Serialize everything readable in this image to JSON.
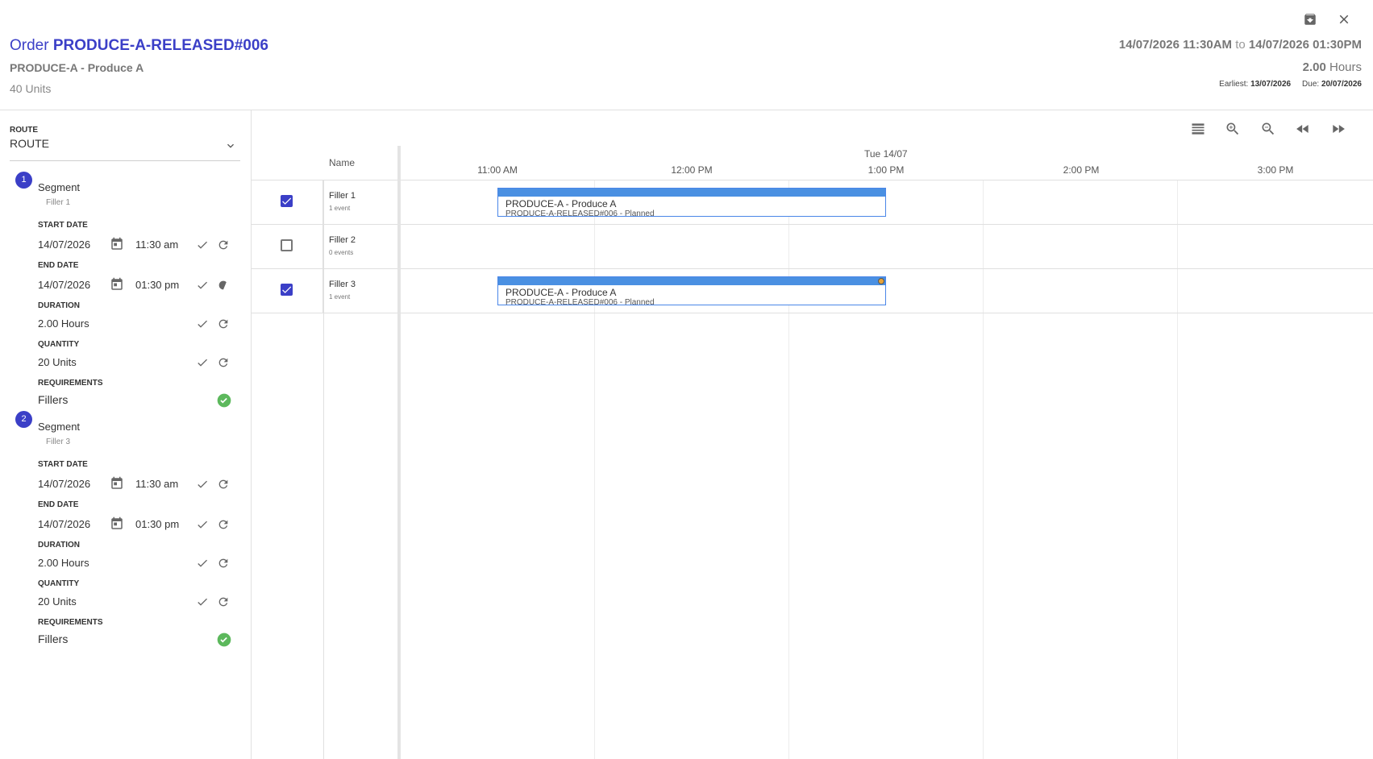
{
  "header": {
    "order_prefix": "Order",
    "order_id": "PRODUCE-A-RELEASED#006",
    "product": "PRODUCE-A - Produce A",
    "units": "40 Units",
    "range_start": "14/07/2026 11:30AM",
    "range_to": "to",
    "range_end": "14/07/2026 01:30PM",
    "hours_value": "2.00",
    "hours_unit": "Hours",
    "earliest_label": "Earliest:",
    "earliest_value": "13/07/2026",
    "due_label": "Due:",
    "due_value": "20/07/2026"
  },
  "sidebar": {
    "route_label": "ROUTE",
    "route_value": "ROUTE",
    "segments": [
      {
        "number": "1",
        "title": "Segment",
        "resource": "Filler 1",
        "start_label": "START DATE",
        "start_date": "14/07/2026",
        "start_time": "11:30 am",
        "end_label": "END DATE",
        "end_date": "14/07/2026",
        "end_time": "01:30 pm",
        "duration_label": "DURATION",
        "duration": "2.00 Hours",
        "quantity_label": "QUANTITY",
        "quantity": "20 Units",
        "requirements_label": "REQUIREMENTS",
        "requirements": "Fillers"
      },
      {
        "number": "2",
        "title": "Segment",
        "resource": "Filler 3",
        "start_label": "START DATE",
        "start_date": "14/07/2026",
        "start_time": "11:30 am",
        "end_label": "END DATE",
        "end_date": "14/07/2026",
        "end_time": "01:30 pm",
        "duration_label": "DURATION",
        "duration": "2.00 Hours",
        "quantity_label": "QUANTITY",
        "quantity": "20 Units",
        "requirements_label": "REQUIREMENTS",
        "requirements": "Fillers"
      }
    ]
  },
  "gantt": {
    "name_header": "Name",
    "date_header": "Tue 14/07",
    "time_labels": [
      "11:00 AM",
      "12:00 PM",
      "1:00 PM",
      "2:00 PM",
      "3:00 PM"
    ],
    "rows": [
      {
        "name": "Filler 1",
        "events": "1 event",
        "checked": true
      },
      {
        "name": "Filler 2",
        "events": "0 events",
        "checked": false
      },
      {
        "name": "Filler 3",
        "events": "1 event",
        "checked": true
      }
    ],
    "event_bars": [
      {
        "title": "PRODUCE-A - Produce A",
        "subtitle": "PRODUCE-A-RELEASED#006 - Planned",
        "start": "11:00 AM",
        "end": "1:00 PM"
      },
      {
        "title": "PRODUCE-A - Produce A",
        "subtitle": "PRODUCE-A-RELEASED#006 - Planned",
        "start": "11:00 AM",
        "end": "1:00 PM"
      }
    ]
  },
  "icons": {
    "archive": "archive-icon",
    "close": "close-icon",
    "toolbar": [
      "list-icon",
      "zoom-in-icon",
      "zoom-out-icon",
      "rewind-icon",
      "fast-forward-icon"
    ]
  },
  "colors": {
    "accent": "#3b3fc7",
    "event_bar": "#4a90e2",
    "success": "#5cb85c",
    "warning_dot": "#e8a33a"
  }
}
